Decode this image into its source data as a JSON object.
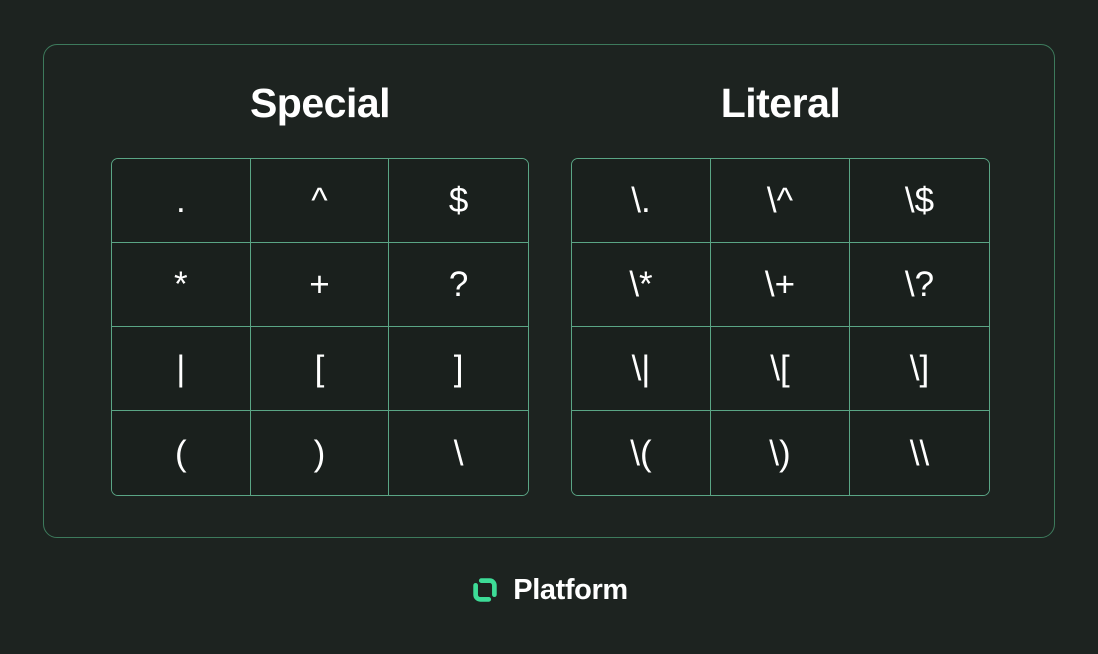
{
  "theme": {
    "page_background": "#1d2320",
    "card_border": "#3d7a5c",
    "table_border": "#5aa585",
    "cell_background": "#1a201d",
    "text_color": "#ffffff",
    "accent": "#3ddc97"
  },
  "panels": [
    {
      "heading": "Special",
      "rows": [
        [
          ".",
          "^",
          "$"
        ],
        [
          "*",
          "+",
          "?"
        ],
        [
          "|",
          "[",
          "]"
        ],
        [
          "(",
          ")",
          "\\"
        ]
      ]
    },
    {
      "heading": "Literal",
      "rows": [
        [
          "\\.",
          "\\^",
          "\\$"
        ],
        [
          "\\*",
          "\\+",
          "\\?"
        ],
        [
          "\\|",
          "\\[",
          "\\]"
        ],
        [
          "\\(",
          "\\)",
          "\\\\"
        ]
      ]
    }
  ],
  "brand": {
    "name": "Platform",
    "mark_icon": "platform-logo-icon",
    "mark_color": "#3ddc97"
  }
}
